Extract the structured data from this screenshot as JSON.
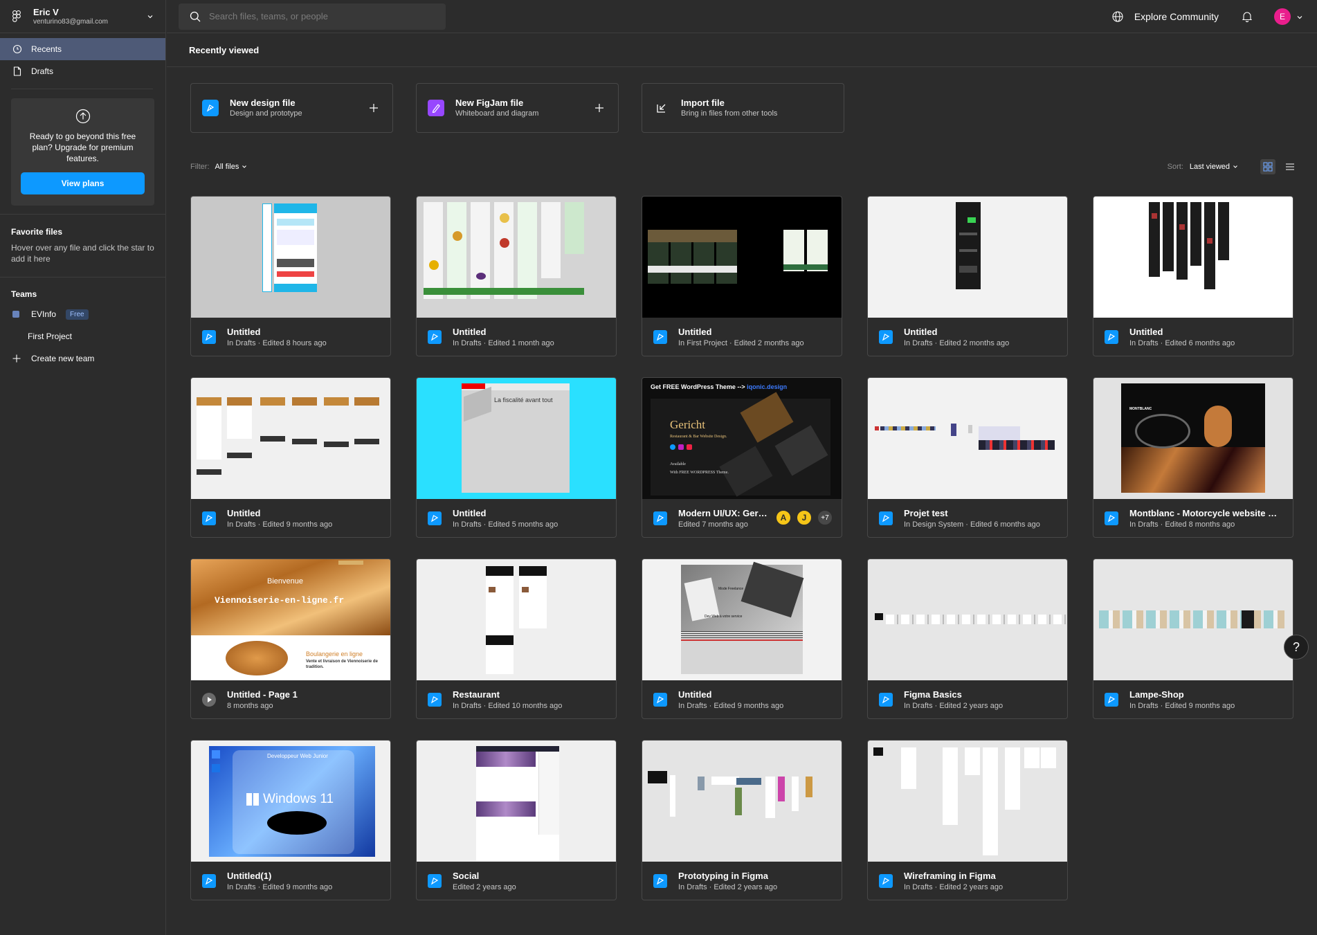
{
  "account": {
    "name": "Eric V",
    "email": "venturino83@gmail.com"
  },
  "nav": {
    "recents": "Recents",
    "drafts": "Drafts"
  },
  "upgrade": {
    "text": "Ready to go beyond this free plan? Upgrade for premium features.",
    "button": "View plans"
  },
  "favorites": {
    "title": "Favorite files",
    "hint": "Hover over any file and click the star to add it here"
  },
  "teams": {
    "title": "Teams",
    "team_name": "EVInfo",
    "badge": "Free",
    "project": "First Project",
    "create": "Create new team"
  },
  "topbar": {
    "search_placeholder": "Search files, teams, or people",
    "explore": "Explore Community",
    "avatar_initial": "E"
  },
  "page": {
    "title": "Recently viewed"
  },
  "create": [
    {
      "title": "New design file",
      "sub": "Design and prototype"
    },
    {
      "title": "New FigJam file",
      "sub": "Whiteboard and diagram"
    },
    {
      "title": "Import file",
      "sub": "Bring in files from other tools"
    }
  ],
  "filter": {
    "label": "Filter:",
    "value": "All files"
  },
  "sort": {
    "label": "Sort:",
    "value": "Last viewed"
  },
  "files": [
    {
      "title": "Untitled",
      "sub": "In Drafts · Edited 8 hours ago"
    },
    {
      "title": "Untitled",
      "sub": "In Drafts · Edited 1 month ago"
    },
    {
      "title": "Untitled",
      "sub": "In First Project · Edited 2 months ago"
    },
    {
      "title": "Untitled",
      "sub": "In Drafts · Edited 2 months ago"
    },
    {
      "title": "Untitled",
      "sub": "In Drafts · Edited 6 months ago"
    },
    {
      "title": "Untitled",
      "sub": "In Drafts · Edited 9 months ago"
    },
    {
      "title": "Untitled",
      "sub": "In Drafts · Edited 5 months ago"
    },
    {
      "title": "Modern UI/UX: Gericht",
      "sub": "Edited 7 months ago",
      "collaborators": [
        "A",
        "J"
      ],
      "more": "+7"
    },
    {
      "title": "Projet test",
      "sub": "In Design System · Edited 6 months ago"
    },
    {
      "title": "Montblanc - Motorcycle website design",
      "sub": "In Drafts · Edited 8 months ago"
    },
    {
      "title": "Untitled - Page 1",
      "sub": "8 months ago"
    },
    {
      "title": "Restaurant",
      "sub": "In Drafts · Edited 10 months ago"
    },
    {
      "title": "Untitled",
      "sub": "In Drafts · Edited 9 months ago"
    },
    {
      "title": "Figma Basics",
      "sub": "In Drafts · Edited 2 years ago"
    },
    {
      "title": "Lampe-Shop",
      "sub": "In Drafts · Edited 9 months ago"
    },
    {
      "title": "Untitled(1)",
      "sub": "In Drafts · Edited 9 months ago"
    },
    {
      "title": "Social",
      "sub": "Edited 2 years ago"
    },
    {
      "title": "Prototyping in Figma",
      "sub": "In Drafts · Edited 2 years ago"
    },
    {
      "title": "Wireframing in Figma",
      "sub": "In Drafts · Edited 2 years ago"
    }
  ],
  "thumb_text": {
    "gericht_banner": "Get FREE WordPress Theme -->",
    "gericht_link": "iqonic.design",
    "gericht_logo": "Gericht",
    "gericht_tag": "Restaurant & Bar Website Design.",
    "gericht_avail": "Available",
    "gericht_wp": "With FREE WORDPRESS Theme.",
    "fiscalite": "La fiscalité avant tout",
    "viennoiserie_welcome": "Bienvenue",
    "viennoiserie_title": "Viennoiserie-en-ligne.fr",
    "boulangerie": "Boulangerie en ligne",
    "boulangerie_sub": "Vente et livraison de Viennoiserie de tradition.",
    "win_title": "Developpeur Web Junior",
    "win_brand": "Windows 11",
    "montblanc": "MONTBLANC",
    "laptop_text": "Mode Freelance",
    "laptop_sub": "Dev Web à votre service"
  },
  "help": "?"
}
